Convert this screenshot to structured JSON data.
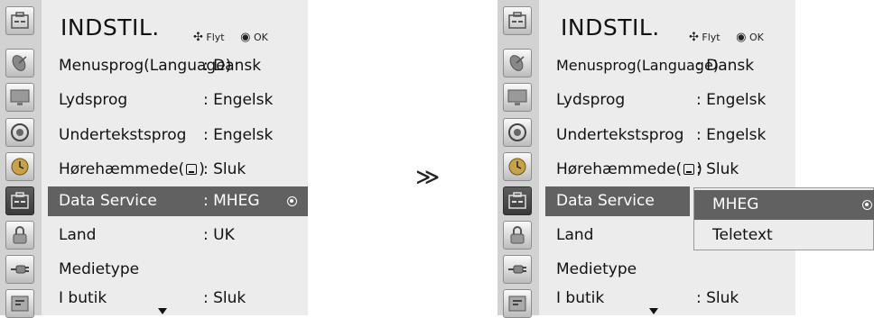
{
  "menu": {
    "title": "INDSTIL.",
    "hint_move_glyph": "✣",
    "hint_move": "Flyt",
    "hint_ok_glyph": "◉",
    "hint_ok": "OK",
    "rows": [
      {
        "label": "Menusprog(Language)",
        "value": ": Dansk"
      },
      {
        "label": "Lydsprog",
        "value": ": Engelsk"
      },
      {
        "label": "Undertekstsprog",
        "value": ": Engelsk"
      },
      {
        "label_before": "Hørehæmmede(",
        "label_after": ")",
        "value": ": Sluk"
      },
      {
        "label": "Data Service",
        "value": ": MHEG"
      },
      {
        "label": "Land",
        "value": ": UK"
      },
      {
        "label": "Medietype",
        "value": ""
      },
      {
        "label": "I butik",
        "value": ": Sluk"
      }
    ]
  },
  "sidebar_icons": [
    "satellite-dish-icon",
    "monitor-icon",
    "speaker-icon",
    "clock-icon",
    "options-icon",
    "lock-icon",
    "input-plug-icon",
    "support-icon"
  ],
  "transition_glyph": "≫",
  "submenu": {
    "options": [
      {
        "label": "MHEG",
        "selected": true
      },
      {
        "label": "Teletext",
        "selected": false
      }
    ]
  },
  "colors": {
    "panel": "#ececec",
    "icon_column": "#d2d2d2",
    "highlight": "#616161"
  }
}
